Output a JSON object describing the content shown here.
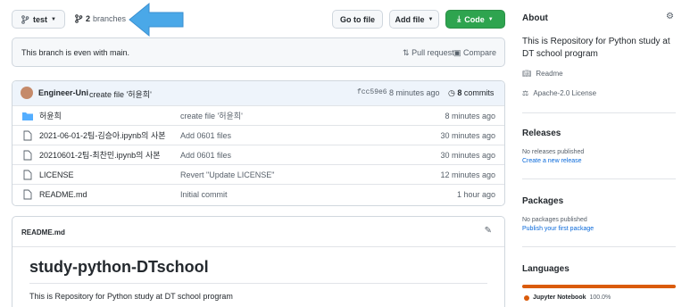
{
  "toolbar": {
    "branch_label": "test",
    "branches_count": "2",
    "branches_label": "branches",
    "goto_file": "Go to file",
    "add_file": "Add file",
    "code": "Code"
  },
  "branch_status": {
    "text": "This branch is even with main.",
    "pull_request": "Pull request",
    "compare": "Compare"
  },
  "commit_bar": {
    "author": "Engineer-Uni",
    "message": "create file '허윤희'",
    "sha": "fcc59e6",
    "time": "8 minutes ago",
    "commits_count": "8",
    "commits_label": "commits"
  },
  "files": [
    {
      "type": "folder",
      "name": "허윤희",
      "message": "create file '허윤희'",
      "time": "8 minutes ago"
    },
    {
      "type": "file",
      "name": "2021-06-01-2팀-김승아.ipynb의 사본",
      "message": "Add 0601 files",
      "time": "30 minutes ago"
    },
    {
      "type": "file",
      "name": "20210601-2팀-최찬민.ipynb의 사본",
      "message": "Add 0601 files",
      "time": "30 minutes ago"
    },
    {
      "type": "file",
      "name": "LICENSE",
      "message": "Revert \"Update LICENSE\"",
      "time": "12 minutes ago"
    },
    {
      "type": "file",
      "name": "README.md",
      "message": "Initial commit",
      "time": "1 hour ago"
    }
  ],
  "readme": {
    "filename": "README.md",
    "heading": "study-python-DTschool",
    "body": "This is Repository for Python study at DT school program"
  },
  "sidebar": {
    "about_title": "About",
    "about_text": "This is Repository for Python study at DT school program",
    "readme_link": "Readme",
    "license_link": "Apache-2.0 License",
    "releases_title": "Releases",
    "releases_none": "No releases published",
    "releases_create": "Create a new release",
    "packages_title": "Packages",
    "packages_none": "No packages published",
    "packages_publish": "Publish your first package",
    "languages_title": "Languages",
    "language_name": "Jupyter Notebook",
    "language_percent": "100.0%"
  },
  "colors": {
    "accent_blue": "#0969da",
    "code_green": "#2ea44f",
    "language_bar": "#DA5B0B",
    "arrow": "#4aa8e8"
  }
}
